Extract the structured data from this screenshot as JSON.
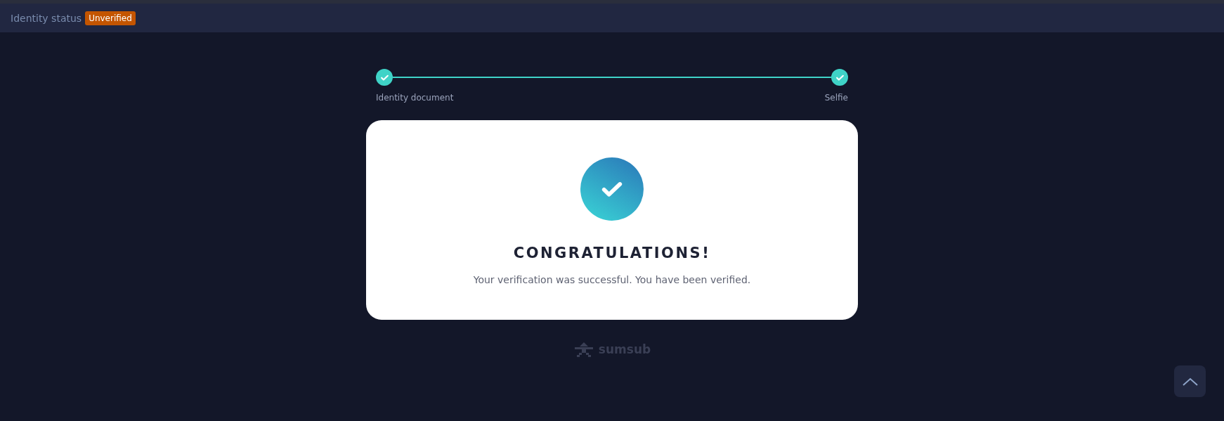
{
  "header": {
    "title": "Identity status",
    "badge": "Unverified"
  },
  "steps": [
    {
      "label": "Identity document",
      "done": true
    },
    {
      "label": "Selfie",
      "done": true
    }
  ],
  "card": {
    "title": "CONGRATULATIONS!",
    "message": "Your verification was successful. You have been verified."
  },
  "footer": {
    "logo_text": "sumsub"
  }
}
